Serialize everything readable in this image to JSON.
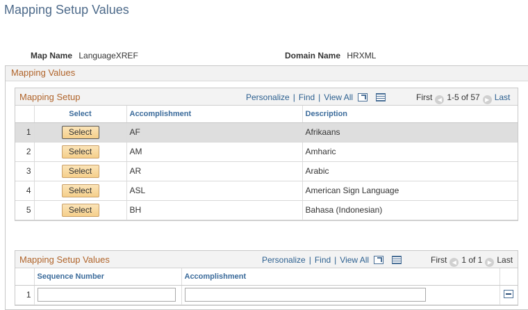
{
  "page": {
    "title": "Mapping Setup Values"
  },
  "info": {
    "map_name_label": "Map Name",
    "map_name_value": "LanguageXREF",
    "domain_name_label": "Domain Name",
    "domain_name_value": "HRXML"
  },
  "mapping_values": {
    "title": "Mapping Values"
  },
  "grid1": {
    "title": "Mapping Setup",
    "personalize": "Personalize",
    "find": "Find",
    "view_all": "View All",
    "first": "First",
    "range": "1-5 of 57",
    "last": "Last",
    "columns": {
      "select": "Select",
      "accomplishment": "Accomplishment",
      "description": "Description"
    },
    "select_label": "Select",
    "rows": [
      {
        "num": "1",
        "accomplishment": "AF",
        "description": "Afrikaans"
      },
      {
        "num": "2",
        "accomplishment": "AM",
        "description": "Amharic"
      },
      {
        "num": "3",
        "accomplishment": "AR",
        "description": "Arabic"
      },
      {
        "num": "4",
        "accomplishment": "ASL",
        "description": "American Sign Language"
      },
      {
        "num": "5",
        "accomplishment": "BH",
        "description": "Bahasa (Indonesian)"
      }
    ]
  },
  "grid2": {
    "title": "Mapping Setup Values",
    "personalize": "Personalize",
    "find": "Find",
    "view_all": "View All",
    "first": "First",
    "range": "1 of 1",
    "last": "Last",
    "columns": {
      "sequence_number": "Sequence Number",
      "accomplishment": "Accomplishment"
    },
    "rows": [
      {
        "num": "1",
        "sequence_number": "",
        "accomplishment": ""
      }
    ]
  }
}
